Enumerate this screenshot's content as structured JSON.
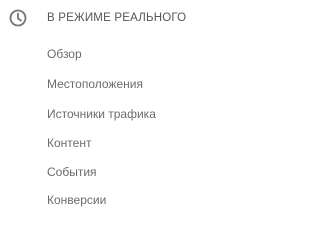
{
  "section": {
    "icon": "clock-icon",
    "title": "В РЕЖИМЕ РЕАЛЬНОГО"
  },
  "items": [
    {
      "label": "Обзор"
    },
    {
      "label": "Местоположения"
    },
    {
      "label": "Источники трафика"
    },
    {
      "label": "Контент"
    },
    {
      "label": "События"
    },
    {
      "label": "Конверсии"
    }
  ],
  "colors": {
    "icon": "#757575",
    "title": "#555555",
    "item": "#6b6b6b"
  }
}
